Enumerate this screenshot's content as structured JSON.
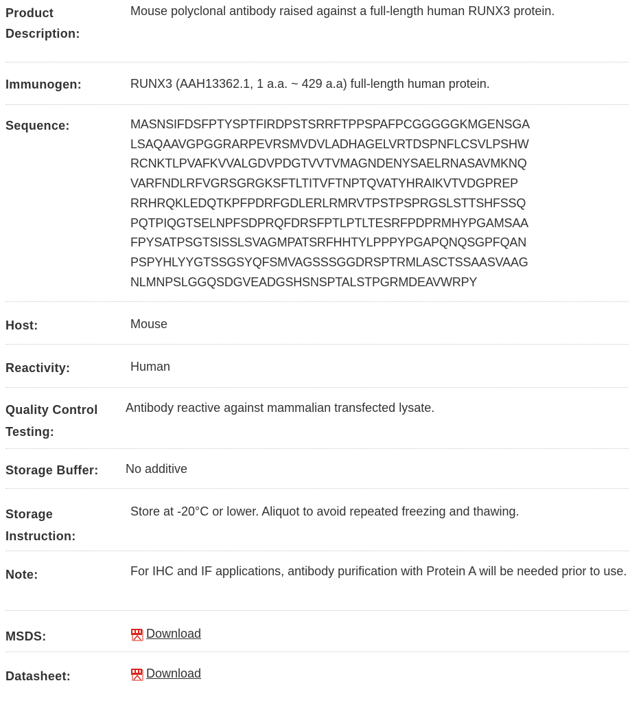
{
  "rows": [
    {
      "label": "Product Description:",
      "value": "Mouse polyclonal antibody raised against a full-length human RUNX3 protein."
    },
    {
      "label": "Immunogen:",
      "value": "RUNX3 (AAH13362.1, 1 a.a. ~ 429 a.a) full-length human protein."
    },
    {
      "label": "Sequence:",
      "lines": [
        "MASNSIFDSFPTYSPTFIRDPSTSRRFTPPSPAFPCGGGGGKMGENSGA",
        "LSAQAAVGPGGRARPEVRSMVDVLADHAGELVRTDSPNFLCSVLPSHW",
        "RCNKTLPVAFKVVALGDVPDGTVVTVMAGNDENYSAELRNASAVMKNQ",
        "VARFNDLRFVGRSGRGKSFTLTITVFTNPTQVATYHRAIKVTVDGPREP",
        "RRHRQKLEDQTKPFPDRFGDLERLRMRVTPSTPSPRGSLSTTSHFSSQ",
        "PQTPIQGTSELNPFSDPRQFDRSFPTLPTLTESRFPDPRMHYPGAMSAA",
        "FPYSATPSGTSISSLSVAGMPATSRFHHTYLPPPYPGAPQNQSGPFQAN",
        "PSPYHLYYGTSSGSYQFSMVAGSSSGGDRSPTRMLASCTSSAASVAAG",
        "NLMNPSLGGQSDGVEADGSHSNSPTALSTPGRMDEAVWRPY"
      ]
    },
    {
      "label": "Host:",
      "value": "Mouse"
    },
    {
      "label": "Reactivity:",
      "value": "Human"
    },
    {
      "label": "Quality Control Testing:",
      "value": "Antibody reactive against mammalian transfected lysate."
    },
    {
      "label": "Storage Buffer:",
      "value": "No additive"
    },
    {
      "label": "Storage Instruction:",
      "value": "Store at -20°C or lower. Aliquot to avoid repeated freezing and thawing."
    },
    {
      "label": "Note:",
      "value": "For IHC and IF applications, antibody purification with Protein A will be needed prior to use."
    },
    {
      "label": "MSDS:",
      "link": "Download",
      "icon": "pdf-icon"
    },
    {
      "label": "Datasheet:",
      "link": "Download",
      "icon": "pdf-icon"
    }
  ],
  "colors": {
    "text": "#333333",
    "divider": "#c8c8c8",
    "pdf_red": "#d9261c"
  }
}
